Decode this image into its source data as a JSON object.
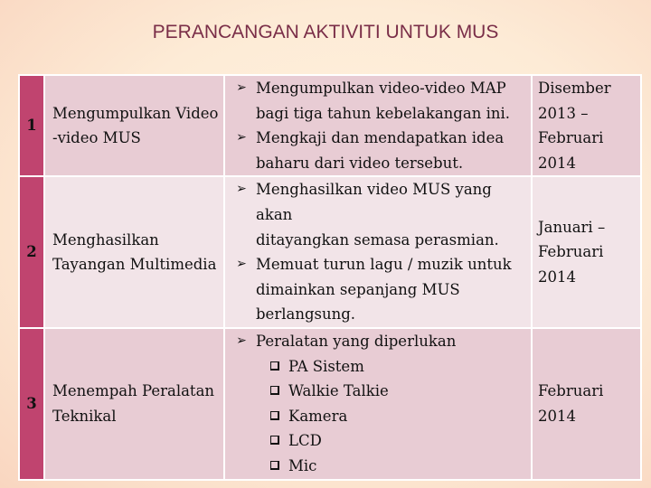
{
  "slide": {
    "title": "PERANCANGAN AKTIVITI UNTUK MUS"
  },
  "colors": {
    "number_column": "#c0446f",
    "row_odd": "#e8ccd4",
    "row_even": "#f2e4e8",
    "title_text": "#7a2e48"
  },
  "rows": [
    {
      "number": "1",
      "name_line1": "Mengumpulkan Video",
      "name_line2": "-video MUS",
      "activities": [
        {
          "line1": "Mengumpulkan video-video MAP",
          "line2": "bagi tiga tahun kebelakangan ini."
        },
        {
          "line1": "Mengkaji dan mendapatkan idea",
          "line2": "baharu dari video tersebut."
        }
      ],
      "date_lines": [
        "Disember",
        "2013 –",
        "Februari",
        "2014"
      ]
    },
    {
      "number": "2",
      "name_line1": "Menghasilkan",
      "name_line2": "Tayangan Multimedia",
      "activities": [
        {
          "line1": "Menghasilkan video MUS yang akan",
          "line2": "ditayangkan semasa perasmian."
        },
        {
          "line1": "Memuat turun lagu / muzik untuk",
          "line2": "dimainkan sepanjang MUS",
          "line3": "berlangsung."
        }
      ],
      "date_lines": [
        "Januari –",
        "Februari",
        "2014"
      ]
    },
    {
      "number": "3",
      "name_line1": "Menempah Peralatan",
      "name_line2": "Teknikal",
      "activities": [
        {
          "line1": "Peralatan yang diperlukan"
        }
      ],
      "equipment": [
        "PA Sistem",
        "Walkie Talkie",
        "Kamera",
        "LCD",
        "Mic"
      ],
      "date_lines": [
        "Februari",
        "2014"
      ]
    }
  ],
  "icons": {
    "bullet": "arrow-bullet-icon",
    "sub_bullet": "checkbox-bullet-icon"
  }
}
